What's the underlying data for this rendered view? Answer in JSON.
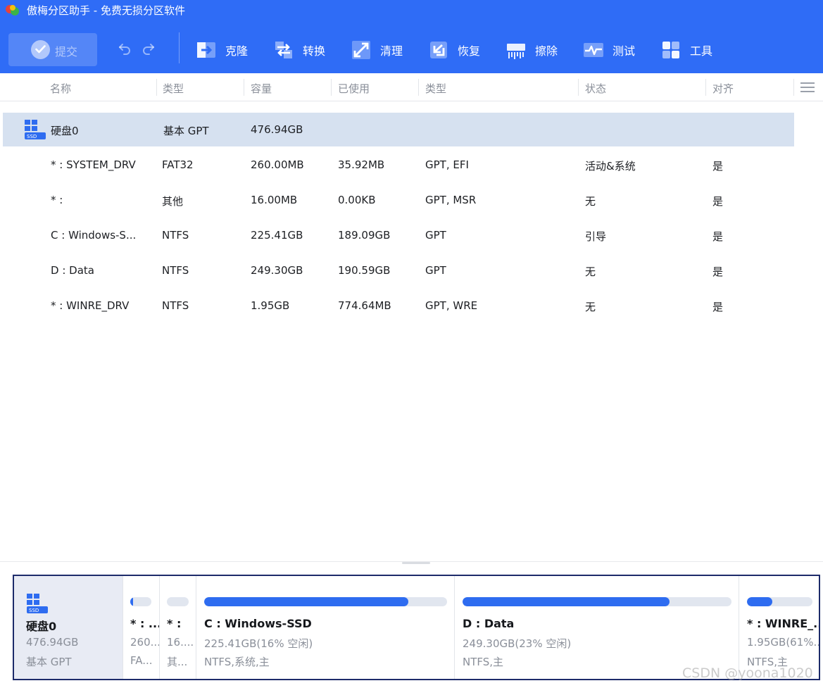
{
  "app": {
    "title": "傲梅分区助手 - 免费无损分区软件"
  },
  "toolbar": {
    "submit_label": "提交",
    "tools": [
      {
        "label": "克隆",
        "icon": "clone-icon"
      },
      {
        "label": "转换",
        "icon": "convert-icon"
      },
      {
        "label": "清理",
        "icon": "clean-icon"
      },
      {
        "label": "恢复",
        "icon": "recover-icon"
      },
      {
        "label": "擦除",
        "icon": "wipe-icon"
      },
      {
        "label": "测试",
        "icon": "test-icon"
      },
      {
        "label": "工具",
        "icon": "tools-icon"
      }
    ]
  },
  "columns": [
    "名称",
    "类型",
    "容量",
    "已使用",
    "类型",
    "状态",
    "对齐"
  ],
  "table": {
    "disk": {
      "name": "硬盘0",
      "type": "基本 GPT",
      "capacity": "476.94GB",
      "icon_label": "SSD"
    },
    "partitions": [
      {
        "name": "* : SYSTEM_DRV",
        "fs": "FAT32",
        "capacity": "260.00MB",
        "used": "35.92MB",
        "type": "GPT, EFI",
        "status": "活动&系统",
        "align": "是"
      },
      {
        "name": "* :",
        "fs": "其他",
        "capacity": "16.00MB",
        "used": "0.00KB",
        "type": "GPT, MSR",
        "status": "无",
        "align": "是"
      },
      {
        "name": "C : Windows-S...",
        "fs": "NTFS",
        "capacity": "225.41GB",
        "used": "189.09GB",
        "type": "GPT",
        "status": "引导",
        "align": "是"
      },
      {
        "name": "D : Data",
        "fs": "NTFS",
        "capacity": "249.30GB",
        "used": "190.59GB",
        "type": "GPT",
        "status": "无",
        "align": "是"
      },
      {
        "name": "* : WINRE_DRV",
        "fs": "NTFS",
        "capacity": "1.95GB",
        "used": "774.64MB",
        "type": "GPT, WRE",
        "status": "无",
        "align": "是"
      }
    ]
  },
  "diskmap": {
    "disk": {
      "name": "硬盘0",
      "size": "476.94GB",
      "type": "基本 GPT",
      "icon_label": "SSD"
    },
    "partitions": [
      {
        "name": "* : ...",
        "line2": "260...",
        "line3": "FA...",
        "used_fraction": 0.14
      },
      {
        "name": "* :",
        "line2": "16....",
        "line3": "其...",
        "used_fraction": 0.0
      },
      {
        "name": "C : Windows-SSD",
        "line2": "225.41GB(16% 空闲)",
        "line3": "NTFS,系统,主",
        "used_fraction": 0.84
      },
      {
        "name": "D : Data",
        "line2": "249.30GB(23% 空闲)",
        "line3": "NTFS,主",
        "used_fraction": 0.77
      },
      {
        "name": "* : WINRE_...",
        "line2": "1.95GB(61%...",
        "line3": "NTFS,主",
        "used_fraction": 0.39
      }
    ]
  },
  "watermark": "CSDN @yoona1020",
  "colors": {
    "toolbar_bg": "#2f6cf6",
    "selected_row": "#d6e1f0",
    "bar_fill": "#2e6cf0",
    "diskmap_border": "#1d2b6a"
  }
}
